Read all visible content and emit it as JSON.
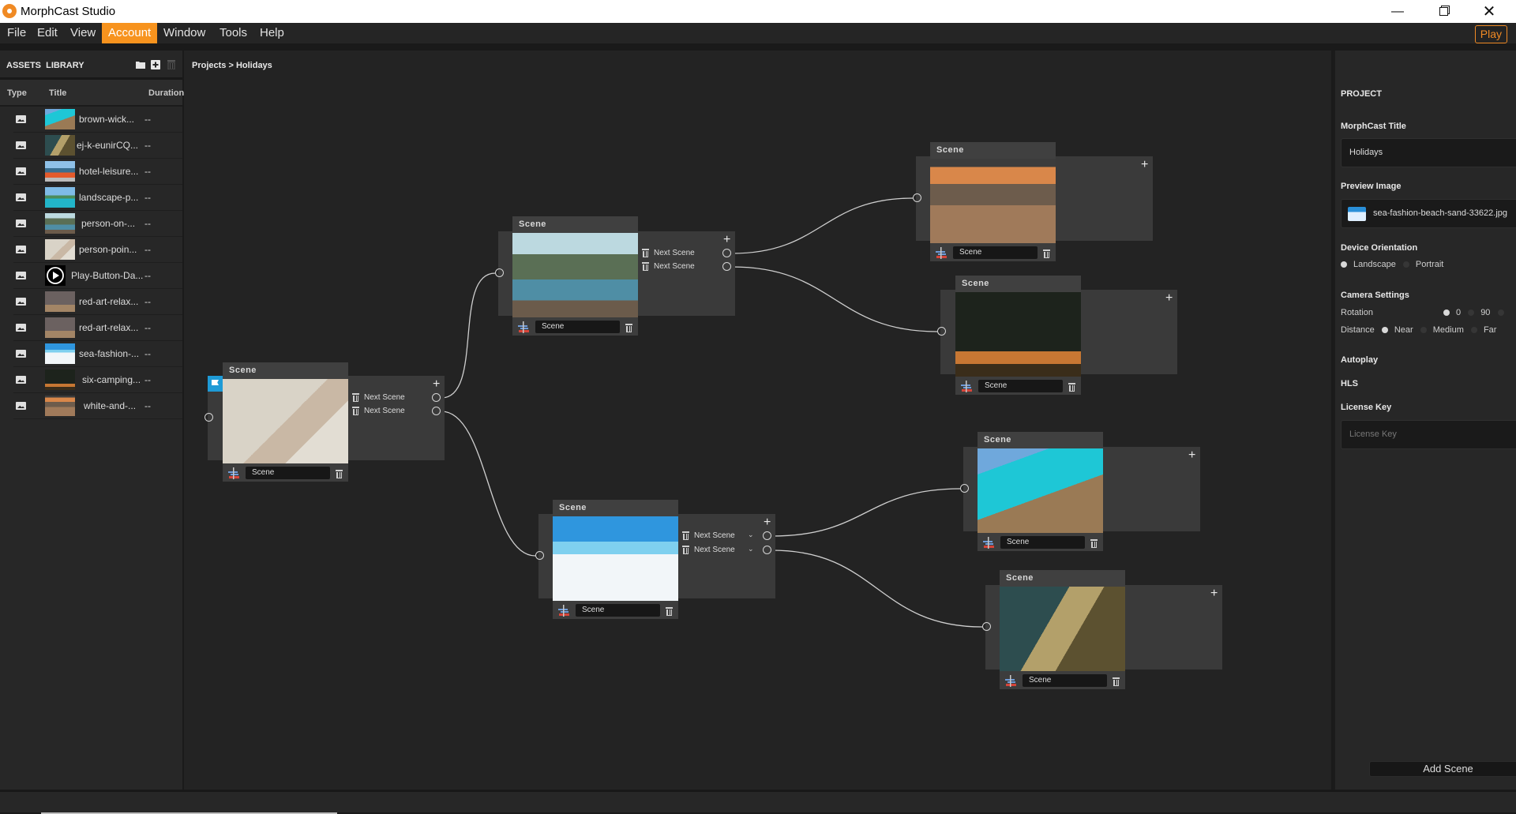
{
  "window": {
    "title": "MorphCast Studio",
    "controls": [
      "minimize",
      "restore",
      "close"
    ]
  },
  "menu": {
    "items": [
      {
        "label": "File",
        "active": false
      },
      {
        "label": "Edit",
        "active": false
      },
      {
        "label": "View",
        "active": false
      },
      {
        "label": "Account",
        "active": true
      },
      {
        "label": "Window",
        "active": false
      },
      {
        "label": "Tools",
        "active": false
      },
      {
        "label": "Help",
        "active": false
      }
    ],
    "play_label": "Play",
    "accent": "#f7931e"
  },
  "assets": {
    "title": "ASSETS  LIBRARY",
    "columns": [
      "Type",
      "Title",
      "Duration"
    ],
    "items": [
      {
        "title": "brown-wick...",
        "duration": "--",
        "type": "image",
        "thumb": "overwater-deck"
      },
      {
        "title": "ej-k-eunirCQ...",
        "duration": "--",
        "type": "image",
        "thumb": "hotel-aerial"
      },
      {
        "title": "hotel-leisure...",
        "duration": "--",
        "type": "image",
        "thumb": "pool-loungers"
      },
      {
        "title": "landscape-p...",
        "duration": "--",
        "type": "image",
        "thumb": "resort-pool"
      },
      {
        "title": "person-on-...",
        "duration": "--",
        "type": "image",
        "thumb": "lake-dock"
      },
      {
        "title": "person-poin...",
        "duration": "--",
        "type": "image",
        "thumb": "map-pointing"
      },
      {
        "title": "Play-Button-Da...",
        "duration": "--",
        "type": "image",
        "thumb": "play-button"
      },
      {
        "title": "red-art-relax...",
        "duration": "--",
        "type": "image",
        "thumb": "art-room"
      },
      {
        "title": "red-art-relax...",
        "duration": "--",
        "type": "image",
        "thumb": "art-room"
      },
      {
        "title": "sea-fashion-...",
        "duration": "--",
        "type": "image",
        "thumb": "beach-hat"
      },
      {
        "title": "six-camping...",
        "duration": "--",
        "type": "image",
        "thumb": "camping"
      },
      {
        "title": "white-and-...",
        "duration": "--",
        "type": "image",
        "thumb": "bedroom-view"
      }
    ]
  },
  "breadcrumb": "Projects > Holidays",
  "graph": {
    "node_title": "Scene",
    "output_label": "Next Scene",
    "nodes": [
      {
        "id": "A",
        "name": "Scene",
        "image": "map-pointing",
        "start": true,
        "outputs": 2,
        "dropdowns": false
      },
      {
        "id": "B",
        "name": "Scene",
        "image": "lake-dock",
        "start": false,
        "outputs": 2,
        "dropdowns": false
      },
      {
        "id": "C",
        "name": "Scene",
        "image": "beach-hat",
        "start": false,
        "outputs": 2,
        "dropdowns": true
      },
      {
        "id": "D",
        "name": "Scene",
        "image": "bedroom-view",
        "start": false,
        "outputs": 0,
        "dropdowns": false
      },
      {
        "id": "E",
        "name": "Scene",
        "image": "camping",
        "start": false,
        "outputs": 0,
        "dropdowns": false
      },
      {
        "id": "F",
        "name": "Scene",
        "image": "overwater-deck",
        "start": false,
        "outputs": 0,
        "dropdowns": false
      },
      {
        "id": "G",
        "name": "Scene",
        "image": "hotel-aerial",
        "start": false,
        "outputs": 0,
        "dropdowns": false
      }
    ],
    "links": [
      {
        "from": "A",
        "port": 0,
        "to": "B"
      },
      {
        "from": "A",
        "port": 1,
        "to": "C"
      },
      {
        "from": "B",
        "port": 0,
        "to": "D"
      },
      {
        "from": "B",
        "port": 1,
        "to": "E"
      },
      {
        "from": "C",
        "port": 0,
        "to": "F"
      },
      {
        "from": "C",
        "port": 1,
        "to": "G"
      }
    ]
  },
  "project": {
    "heading": "PROJECT",
    "title_label": "MorphCast Title",
    "title_value": "Holidays",
    "preview_label": "Preview Image",
    "preview_value": "sea-fashion-beach-sand-33622.jpg",
    "orientation_label": "Device Orientation",
    "orientation_options": [
      "Landscape",
      "Portrait"
    ],
    "orientation_selected": "Landscape",
    "camera_label": "Camera Settings",
    "rotation_label": "Rotation",
    "rotation_options": [
      "0",
      "90"
    ],
    "rotation_selected": "0",
    "distance_label": "Distance",
    "distance_options": [
      "Near",
      "Medium",
      "Far"
    ],
    "distance_selected": "Near",
    "autoplay_label": "Autoplay",
    "hls_label": "HLS",
    "license_label": "License Key",
    "license_placeholder": "License Key",
    "add_scene_label": "Add Scene"
  }
}
